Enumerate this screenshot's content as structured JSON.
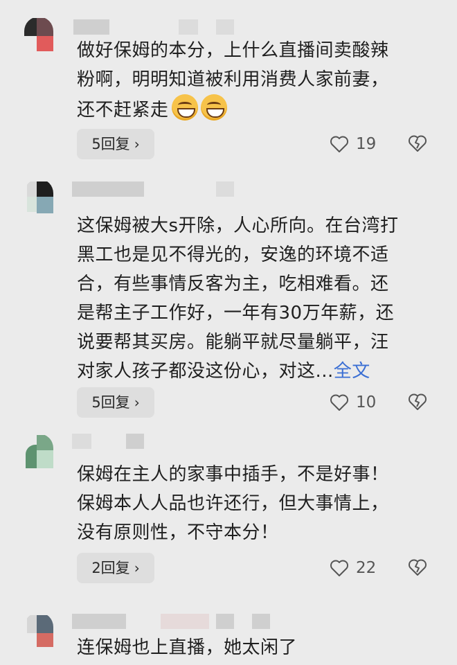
{
  "comments": [
    {
      "lines": [
        "做好保姆的本分，上什么直播间卖酸辣",
        "粉啊，明明知道被利用消费人家前妻，",
        "还不赶紧走"
      ],
      "reply_label": "5回复",
      "likes": "19"
    },
    {
      "lines": [
        "这保姆被大s开除，人心所向。在台湾打",
        "黑工也是见不得光的，安逸的环境不适",
        "合，有些事情反客为主，吃相难看。还",
        "是帮主子工作好，一年有30万年薪，还",
        "说要帮其买房。能躺平就尽量躺平，汪",
        "对家人孩子都没这份心，对这..."
      ],
      "full_text_link": "全文",
      "reply_label": "5回复",
      "likes": "10"
    },
    {
      "lines": [
        "保姆在主人的家事中插手，不是好事！",
        "保姆本人人品也许还行，但大事情上，",
        "没有原则性，不守本分！"
      ],
      "reply_label": "2回复",
      "likes": "22"
    },
    {
      "lines": [
        "连保姆也上直播，她太闲了"
      ]
    }
  ],
  "icons": {
    "reply_chevron": "›",
    "like": "heart-outline-icon",
    "dislike": "broken-heart-icon",
    "emoji": "grinning-face-emoji"
  },
  "colors": {
    "background": "#ebebeb",
    "link": "#3b6fd4",
    "reply_button_bg": "#dedede"
  }
}
